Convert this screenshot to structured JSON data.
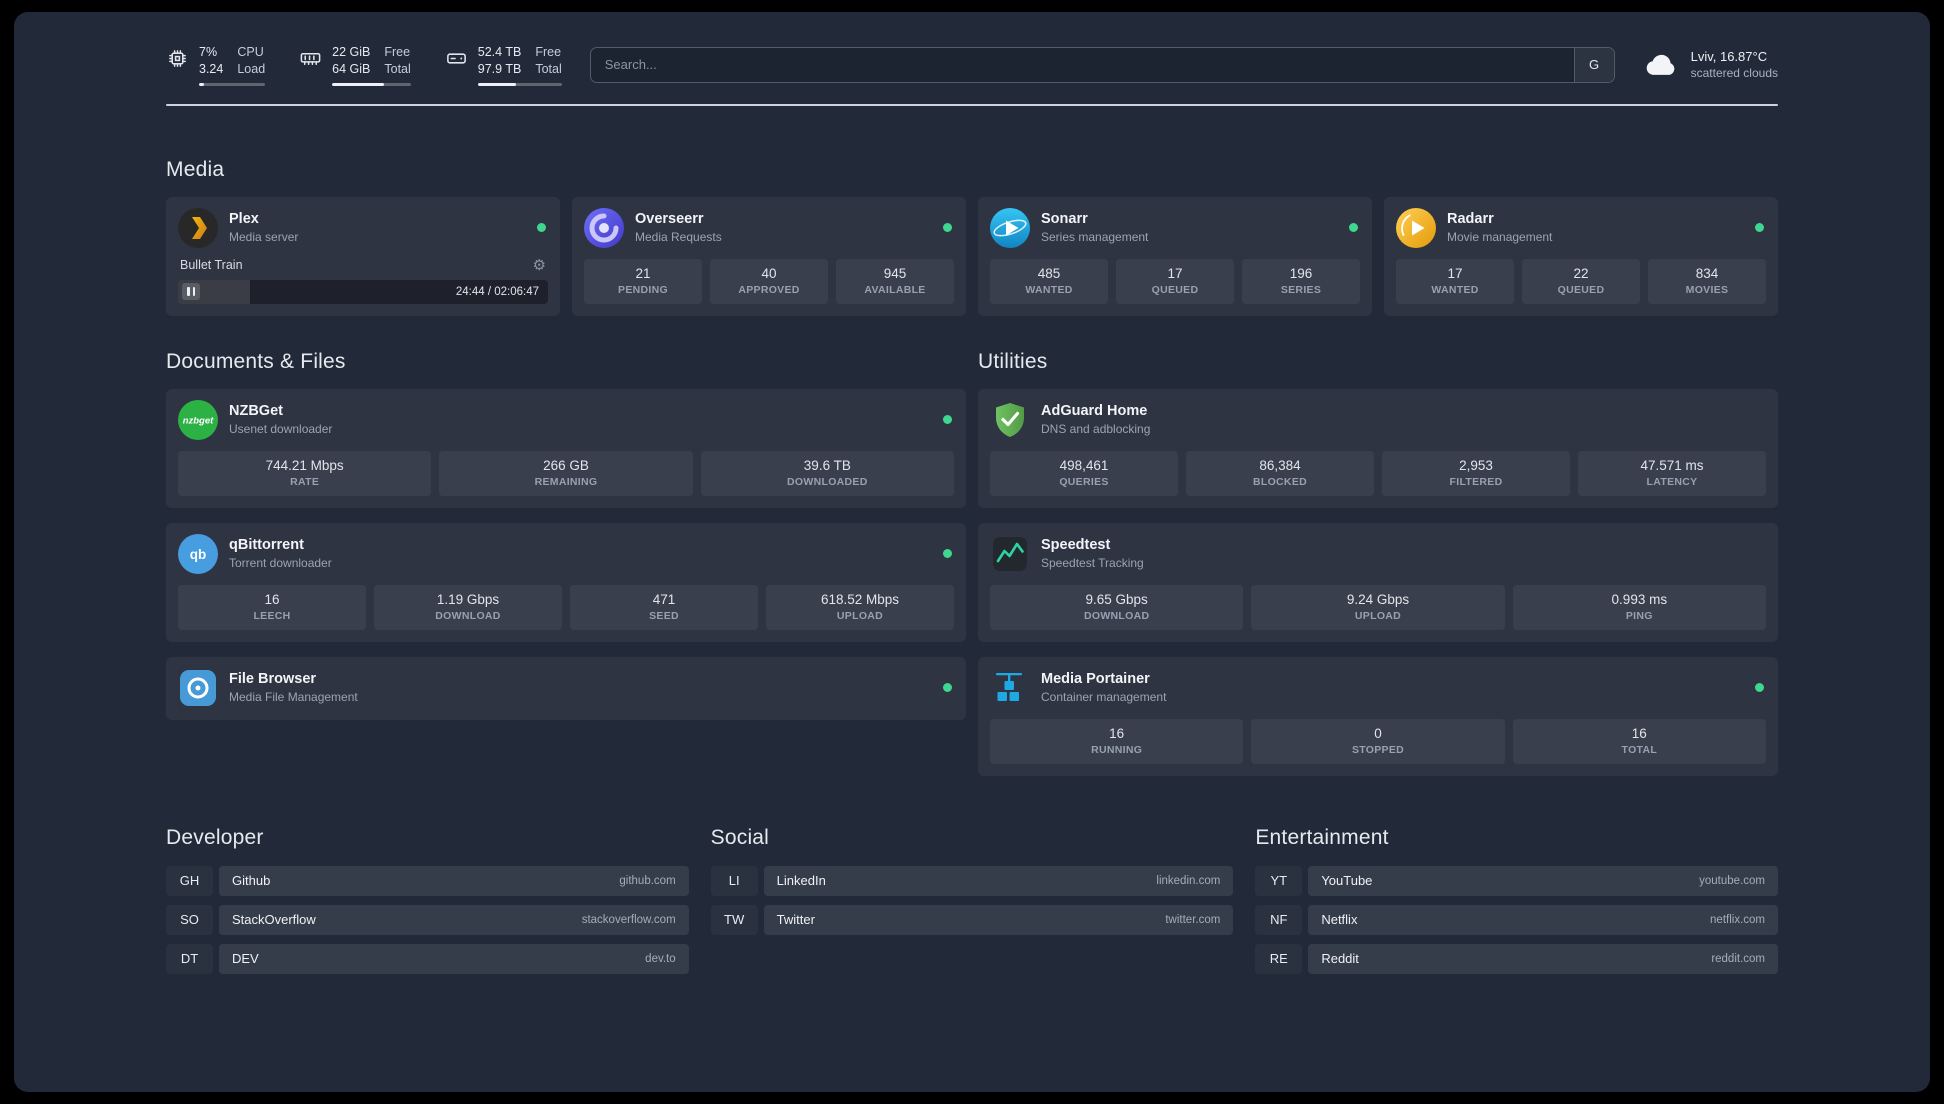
{
  "topbar": {
    "resources": [
      {
        "id": "cpu",
        "value_top": "7%",
        "value_bottom": "3.24",
        "label_top": "CPU",
        "label_bottom": "Load",
        "progress": 7
      },
      {
        "id": "memory",
        "value_top": "22 GiB",
        "value_bottom": "64 GiB",
        "label_top": "Free",
        "label_bottom": "Total",
        "progress": 66
      },
      {
        "id": "disk",
        "value_top": "52.4 TB",
        "value_bottom": "97.9 TB",
        "label_top": "Free",
        "label_bottom": "Total",
        "progress": 46
      }
    ],
    "search": {
      "placeholder": "Search...",
      "provider_label": "G"
    },
    "weather": {
      "location": "Lviv, 16.87°C",
      "condition": "scattered clouds"
    }
  },
  "sections": {
    "media": {
      "heading": "Media",
      "plex": {
        "name": "Plex",
        "subtitle": "Media server",
        "now_playing": "Bullet Train",
        "time": "24:44 / 02:06:47",
        "progress": 19.5
      },
      "overseerr": {
        "name": "Overseerr",
        "subtitle": "Media Requests",
        "stats": [
          {
            "value": "21",
            "label": "PENDING"
          },
          {
            "value": "40",
            "label": "APPROVED"
          },
          {
            "value": "945",
            "label": "AVAILABLE"
          }
        ]
      },
      "sonarr": {
        "name": "Sonarr",
        "subtitle": "Series management",
        "stats": [
          {
            "value": "485",
            "label": "WANTED"
          },
          {
            "value": "17",
            "label": "QUEUED"
          },
          {
            "value": "196",
            "label": "SERIES"
          }
        ]
      },
      "radarr": {
        "name": "Radarr",
        "subtitle": "Movie management",
        "stats": [
          {
            "value": "17",
            "label": "WANTED"
          },
          {
            "value": "22",
            "label": "QUEUED"
          },
          {
            "value": "834",
            "label": "MOVIES"
          }
        ]
      }
    },
    "documents": {
      "heading": "Documents & Files",
      "nzbget": {
        "name": "NZBGet",
        "subtitle": "Usenet downloader",
        "stats": [
          {
            "value": "744.21 Mbps",
            "label": "RATE"
          },
          {
            "value": "266 GB",
            "label": "REMAINING"
          },
          {
            "value": "39.6 TB",
            "label": "DOWNLOADED"
          }
        ]
      },
      "qbittorrent": {
        "name": "qBittorrent",
        "subtitle": "Torrent downloader",
        "stats": [
          {
            "value": "16",
            "label": "LEECH"
          },
          {
            "value": "1.19 Gbps",
            "label": "DOWNLOAD"
          },
          {
            "value": "471",
            "label": "SEED"
          },
          {
            "value": "618.52 Mbps",
            "label": "UPLOAD"
          }
        ]
      },
      "filebrowser": {
        "name": "File Browser",
        "subtitle": "Media File Management"
      }
    },
    "utilities": {
      "heading": "Utilities",
      "adguard": {
        "name": "AdGuard Home",
        "subtitle": "DNS and adblocking",
        "stats": [
          {
            "value": "498,461",
            "label": "QUERIES"
          },
          {
            "value": "86,384",
            "label": "BLOCKED"
          },
          {
            "value": "2,953",
            "label": "FILTERED"
          },
          {
            "value": "47.571 ms",
            "label": "LATENCY"
          }
        ]
      },
      "speedtest": {
        "name": "Speedtest",
        "subtitle": "Speedtest Tracking",
        "stats": [
          {
            "value": "9.65 Gbps",
            "label": "DOWNLOAD"
          },
          {
            "value": "9.24 Gbps",
            "label": "UPLOAD"
          },
          {
            "value": "0.993 ms",
            "label": "PING"
          }
        ]
      },
      "portainer": {
        "name": "Media Portainer",
        "subtitle": "Container management",
        "stats": [
          {
            "value": "16",
            "label": "RUNNING"
          },
          {
            "value": "0",
            "label": "STOPPED"
          },
          {
            "value": "16",
            "label": "TOTAL"
          }
        ]
      }
    }
  },
  "bookmarks": {
    "developer": {
      "heading": "Developer",
      "items": [
        {
          "abbr": "GH",
          "name": "Github",
          "domain": "github.com"
        },
        {
          "abbr": "SO",
          "name": "StackOverflow",
          "domain": "stackoverflow.com"
        },
        {
          "abbr": "DT",
          "name": "DEV",
          "domain": "dev.to"
        }
      ]
    },
    "social": {
      "heading": "Social",
      "items": [
        {
          "abbr": "LI",
          "name": "LinkedIn",
          "domain": "linkedin.com"
        },
        {
          "abbr": "TW",
          "name": "Twitter",
          "domain": "twitter.com"
        }
      ]
    },
    "entertainment": {
      "heading": "Entertainment",
      "items": [
        {
          "abbr": "YT",
          "name": "YouTube",
          "domain": "youtube.com"
        },
        {
          "abbr": "NF",
          "name": "Netflix",
          "domain": "netflix.com"
        },
        {
          "abbr": "RE",
          "name": "Reddit",
          "domain": "reddit.com"
        }
      ]
    }
  },
  "colors": {
    "background": "#222938",
    "status_online": "#3fd68f",
    "accent_plex": "#e5a00d"
  }
}
